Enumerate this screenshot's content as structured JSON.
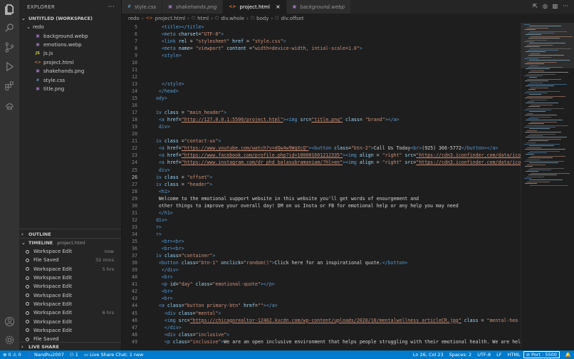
{
  "sidebar": {
    "explorer_title": "EXPLORER",
    "more_icon": "more-icon",
    "workspace_title": "UNTITLED (WORKSPACE)",
    "folder": "redo",
    "files": [
      {
        "name": "background.webp",
        "icon": "image-icon"
      },
      {
        "name": "emotions.webp",
        "icon": "image-icon"
      },
      {
        "name": "js.js",
        "icon": "js-file-icon"
      },
      {
        "name": "project.html",
        "icon": "html-file-icon"
      },
      {
        "name": "shakehands.png",
        "icon": "image-icon"
      },
      {
        "name": "style.css",
        "icon": "css-file-icon"
      },
      {
        "name": "title.png",
        "icon": "image-icon"
      }
    ],
    "outline_title": "OUTLINE",
    "timeline_title": "TIMELINE",
    "timeline_file": "project.html",
    "timeline": [
      {
        "label": "Workspace Edit",
        "time": "now"
      },
      {
        "label": "File Saved",
        "time": "32 mins"
      },
      {
        "label": "Workspace Edit",
        "time": "5 hrs"
      },
      {
        "label": "Workspace Edit",
        "time": ""
      },
      {
        "label": "Workspace Edit",
        "time": ""
      },
      {
        "label": "Workspace Edit",
        "time": ""
      },
      {
        "label": "Workspace Edit",
        "time": ""
      },
      {
        "label": "Workspace Edit",
        "time": "6 hrs"
      },
      {
        "label": "Workspace Edit",
        "time": ""
      },
      {
        "label": "Workspace Edit",
        "time": ""
      },
      {
        "label": "File Saved",
        "time": ""
      }
    ],
    "live_share_title": "LIVE SHARE"
  },
  "tabs": [
    {
      "label": "style.css",
      "icon": "#",
      "icon_color": "#519aba",
      "active": false
    },
    {
      "label": "shakehands.png",
      "icon": "▣",
      "icon_color": "#a074c4",
      "active": false
    },
    {
      "label": "project.html",
      "icon": "<>",
      "icon_color": "#e37933",
      "active": true
    },
    {
      "label": "background.webp",
      "icon": "▣",
      "icon_color": "#a074c4",
      "active": false
    }
  ],
  "breadcrumb": [
    "redo",
    "project.html",
    "html",
    "div.whole",
    "body",
    "div.offset"
  ],
  "code_lines": [
    {
      "n": "5",
      "c": [
        [
          "tx",
          "    "
        ],
        [
          "tg",
          "<title></title>"
        ]
      ]
    },
    {
      "n": "6",
      "c": [
        [
          "tx",
          "    "
        ],
        [
          "tg",
          "<meta "
        ],
        [
          "at",
          "charset"
        ],
        [
          "tx",
          "="
        ],
        [
          "st",
          "\"UTF-8\""
        ],
        [
          "tg",
          ">"
        ]
      ]
    },
    {
      "n": "7",
      "c": [
        [
          "tx",
          "    "
        ],
        [
          "tg",
          "<link "
        ],
        [
          "at",
          "rel"
        ],
        [
          "tx",
          " = "
        ],
        [
          "st",
          "\"stylesheet\""
        ],
        [
          "at",
          " href"
        ],
        [
          "tx",
          " = "
        ],
        [
          "st",
          "\"style.css\""
        ],
        [
          "tg",
          ">"
        ]
      ]
    },
    {
      "n": "8",
      "c": [
        [
          "tx",
          "    "
        ],
        [
          "tg",
          "<meta "
        ],
        [
          "at",
          "name"
        ],
        [
          "tx",
          "= "
        ],
        [
          "st",
          "\"viewport\""
        ],
        [
          "at",
          " content"
        ],
        [
          "tx",
          " ="
        ],
        [
          "st",
          "\"width=device-width, intial-scale=1.0\""
        ],
        [
          "tg",
          ">"
        ]
      ]
    },
    {
      "n": "9",
      "c": [
        [
          "tx",
          "    "
        ],
        [
          "tg",
          "<style>"
        ]
      ]
    },
    {
      "n": "10",
      "c": []
    },
    {
      "n": "11",
      "c": []
    },
    {
      "n": "12",
      "c": []
    },
    {
      "n": "13",
      "c": [
        [
          "tx",
          "    "
        ],
        [
          "tg",
          "</style>"
        ]
      ]
    },
    {
      "n": "14",
      "c": [
        [
          "tx",
          "   "
        ],
        [
          "tg",
          "</head>"
        ]
      ]
    },
    {
      "n": "15",
      "c": [
        [
          "tx",
          "  "
        ],
        [
          "tg",
          "ody>"
        ]
      ]
    },
    {
      "n": "16",
      "c": []
    },
    {
      "n": "17",
      "c": [
        [
          "tg",
          "  iv "
        ],
        [
          "at",
          "class"
        ],
        [
          "tx",
          " = "
        ],
        [
          "st",
          "\"main_header\""
        ],
        [
          "tg",
          ">"
        ]
      ]
    },
    {
      "n": "18",
      "c": [
        [
          "tx",
          "   "
        ],
        [
          "tg",
          "<a "
        ],
        [
          "at",
          "href"
        ],
        [
          "tx",
          "="
        ],
        [
          "lnk",
          "\"http://127.0.0.1:5500/project.html\""
        ],
        [
          "tg",
          "><img "
        ],
        [
          "at",
          "src"
        ],
        [
          "tx",
          "="
        ],
        [
          "lnk",
          "\"title.png\""
        ],
        [
          "at",
          " class"
        ],
        [
          "tx",
          "= "
        ],
        [
          "st",
          "\"brand\""
        ],
        [
          "tg",
          "></a>"
        ]
      ]
    },
    {
      "n": "19",
      "c": [
        [
          "tx",
          "   "
        ],
        [
          "tg",
          "div>"
        ]
      ]
    },
    {
      "n": "20",
      "c": []
    },
    {
      "n": "21",
      "c": [
        [
          "tg",
          "  iv "
        ],
        [
          "at",
          "class"
        ],
        [
          "tx",
          " ="
        ],
        [
          "st",
          "\"contact-us\""
        ],
        [
          "tg",
          ">"
        ]
      ]
    },
    {
      "n": "22",
      "c": [
        [
          "tx",
          "   "
        ],
        [
          "tg",
          "<a "
        ],
        [
          "at",
          "href"
        ],
        [
          "tx",
          "="
        ],
        [
          "lnk",
          "\"https://www.youtube.com/watch?v=dQw4w9WgXcQ\""
        ],
        [
          "tg",
          "><button "
        ],
        [
          "at",
          "class"
        ],
        [
          "tx",
          "="
        ],
        [
          "st",
          "\"btn-2\""
        ],
        [
          "tg",
          ">"
        ],
        [
          "tx",
          "Call Us Today"
        ],
        [
          "tg",
          "<br>"
        ],
        [
          "tx",
          "(925) 366-5772"
        ],
        [
          "tg",
          "</button></a>"
        ]
      ]
    },
    {
      "n": "23",
      "c": [
        [
          "tx",
          "   "
        ],
        [
          "tg",
          "<a "
        ],
        [
          "at",
          "href"
        ],
        [
          "tx",
          "="
        ],
        [
          "lnk",
          "\"https://www.facebook.com/profile.php?id=100081601212335\""
        ],
        [
          "tg",
          "><img "
        ],
        [
          "at",
          "align"
        ],
        [
          "tx",
          " = "
        ],
        [
          "st",
          "\"right\""
        ],
        [
          "at",
          " src"
        ],
        [
          "tx",
          "="
        ],
        [
          "lnk",
          "\"https://cdn3.iconfinder.com/data/ico"
        ]
      ]
    },
    {
      "n": "24",
      "c": [
        [
          "tx",
          "   "
        ],
        [
          "tg",
          "<a "
        ],
        [
          "at",
          "href"
        ],
        [
          "tx",
          "="
        ],
        [
          "lnk",
          "\"https://www.instagram.com/dr_phd_balasubramaniam/?hl=en\""
        ],
        [
          "tg",
          "><img "
        ],
        [
          "at",
          "align"
        ],
        [
          "tx",
          " = "
        ],
        [
          "st",
          "\"right\""
        ],
        [
          "at",
          " src"
        ],
        [
          "tx",
          "="
        ],
        [
          "lnk",
          "\"https://cdn3.iconfinder.com/data/ico"
        ]
      ]
    },
    {
      "n": "25",
      "c": [
        [
          "tx",
          "   "
        ],
        [
          "tg",
          "div>"
        ]
      ]
    },
    {
      "n": "26",
      "c": [
        [
          "tg",
          "  iv "
        ],
        [
          "at",
          "class"
        ],
        [
          "tx",
          " = "
        ],
        [
          "st",
          "\"offset\""
        ],
        [
          "tg",
          ">"
        ]
      ]
    },
    {
      "n": "27",
      "c": [
        [
          "tg",
          "  iv "
        ],
        [
          "at",
          "class"
        ],
        [
          "tx",
          " = "
        ],
        [
          "st",
          "\"header\""
        ],
        [
          "tg",
          ">"
        ]
      ]
    },
    {
      "n": "28",
      "c": [
        [
          "tx",
          "   "
        ],
        [
          "tg",
          "<h1>"
        ]
      ]
    },
    {
      "n": "29",
      "c": [
        [
          "tx",
          "   Welcome to the emotional support website in this website you'll get words of enourgement and"
        ]
      ]
    },
    {
      "n": "30",
      "c": [
        [
          "tx",
          "   other things to improve your overall day! DM on us Insta or FB for emotional help or any help you may need"
        ]
      ]
    },
    {
      "n": "31",
      "c": [
        [
          "tx",
          "   "
        ],
        [
          "tg",
          "</h1>"
        ]
      ]
    },
    {
      "n": "32",
      "c": [
        [
          "tx",
          "  "
        ],
        [
          "tg",
          "div>"
        ]
      ]
    },
    {
      "n": "33",
      "c": [
        [
          "tx",
          "  "
        ],
        [
          "tg",
          "r>"
        ]
      ]
    },
    {
      "n": "34",
      "c": [
        [
          "tx",
          "  "
        ],
        [
          "tg",
          "r>"
        ]
      ]
    },
    {
      "n": "35",
      "c": [
        [
          "tx",
          "    "
        ],
        [
          "tg",
          "<br><br>"
        ]
      ]
    },
    {
      "n": "36",
      "c": [
        [
          "tx",
          "    "
        ],
        [
          "tg",
          "<br><br>"
        ]
      ]
    },
    {
      "n": "37",
      "c": [
        [
          "tg",
          "  iv "
        ],
        [
          "at",
          "class"
        ],
        [
          "tx",
          "="
        ],
        [
          "st",
          "\"container\""
        ],
        [
          "tg",
          ">"
        ]
      ]
    },
    {
      "n": "38",
      "c": [
        [
          "tx",
          "   "
        ],
        [
          "tg",
          "<button "
        ],
        [
          "at",
          "class"
        ],
        [
          "tx",
          "="
        ],
        [
          "st",
          "\"btn-1\""
        ],
        [
          "at",
          " onclick"
        ],
        [
          "tx",
          "="
        ],
        [
          "st",
          "\"random()\""
        ],
        [
          "tg",
          ">"
        ],
        [
          "tx",
          "Click here for an inspirational quote."
        ],
        [
          "tg",
          "</button>"
        ]
      ]
    },
    {
      "n": "39",
      "c": [
        [
          "tx",
          "    "
        ],
        [
          "tg",
          "</div>"
        ]
      ]
    },
    {
      "n": "40",
      "c": [
        [
          "tx",
          "    "
        ],
        [
          "tg",
          "<br>"
        ]
      ]
    },
    {
      "n": "41",
      "c": [
        [
          "tx",
          "    "
        ],
        [
          "tg",
          "<p "
        ],
        [
          "at",
          "id"
        ],
        [
          "tx",
          "="
        ],
        [
          "st",
          "\"day\""
        ],
        [
          "at",
          " class"
        ],
        [
          "tx",
          "="
        ],
        [
          "st",
          "\"emotional-quote\""
        ],
        [
          "tg",
          "></p>"
        ]
      ]
    },
    {
      "n": "42",
      "c": [
        [
          "tx",
          "    "
        ],
        [
          "tg",
          "<br>"
        ]
      ]
    },
    {
      "n": "43",
      "c": [
        [
          "tx",
          "    "
        ],
        [
          "tg",
          "<br>"
        ]
      ]
    },
    {
      "n": "44",
      "c": [
        [
          "tx",
          "   "
        ],
        [
          "tg",
          "<a "
        ],
        [
          "at",
          "class"
        ],
        [
          "tx",
          "="
        ],
        [
          "st",
          "\"button primary-btn\""
        ],
        [
          "at",
          " href"
        ],
        [
          "tx",
          "="
        ],
        [
          "st",
          "\"\""
        ],
        [
          "tg",
          "></a>"
        ]
      ]
    },
    {
      "n": "45",
      "c": [
        [
          "tx",
          "     "
        ],
        [
          "tg",
          "<div "
        ],
        [
          "at",
          "class"
        ],
        [
          "tx",
          "="
        ],
        [
          "st",
          "\"mental\""
        ],
        [
          "tg",
          ">"
        ]
      ]
    },
    {
      "n": "46",
      "c": [
        [
          "tx",
          "     "
        ],
        [
          "tg",
          "<img "
        ],
        [
          "at",
          "src"
        ],
        [
          "tx",
          "="
        ],
        [
          "lnk",
          "\"https://chicagorealtor-12462.kxcdn.com/wp-content/uploads/2020/10/mentalwellness_articleCR.jpg\""
        ],
        [
          "at",
          " class"
        ],
        [
          "tx",
          " = "
        ],
        [
          "st",
          "\"mental-hea"
        ]
      ]
    },
    {
      "n": "47",
      "c": [
        [
          "tx",
          "     "
        ],
        [
          "tg",
          "</div>"
        ]
      ]
    },
    {
      "n": "48",
      "c": [
        [
          "tx",
          "     "
        ],
        [
          "tg",
          "<div "
        ],
        [
          "at",
          "class"
        ],
        [
          "tx",
          "="
        ],
        [
          "st",
          "\"inclusive\""
        ],
        [
          "tg",
          ">"
        ]
      ]
    },
    {
      "n": "49",
      "c": [
        [
          "tx",
          "     "
        ],
        [
          "tg",
          "<p "
        ],
        [
          "at",
          "class"
        ],
        [
          "tx",
          "="
        ],
        [
          "st",
          "\"inclusive\""
        ],
        [
          "tg",
          ">"
        ],
        [
          "tx",
          "We are an open inclusive environment that helps people struggling with their emotional health. We are hel"
        ]
      ]
    }
  ],
  "status": {
    "errors": "0",
    "warnings": "0",
    "user": "Nandhu2007",
    "live_count": "1",
    "live_share": "Live Share Chat: 1 new",
    "position": "Ln 26, Col 23",
    "spaces": "Spaces: 2",
    "encoding": "UTF-8",
    "eol": "LF",
    "language": "HTML",
    "port": "Port : 5500"
  },
  "colors": {
    "accent": "#007acc",
    "editor_bg": "#1e1e1e",
    "sidebar_bg": "#252526"
  }
}
